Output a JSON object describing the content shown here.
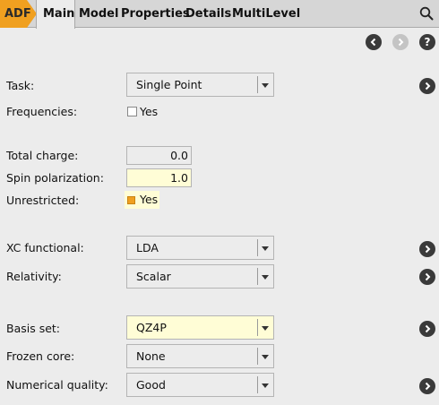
{
  "topbar": {
    "adf_label": "ADF",
    "tabs": [
      "Main",
      "Model",
      "Properties",
      "Details",
      "MultiLevel"
    ]
  },
  "nav": {
    "back_icon": "chevron-left-icon",
    "forward_icon": "chevron-right-icon",
    "help_label": "?"
  },
  "form": {
    "task": {
      "label": "Task:",
      "value": "Single Point"
    },
    "frequencies": {
      "label": "Frequencies:",
      "checkbox_label": "Yes",
      "checked": false
    },
    "total_charge": {
      "label": "Total charge:",
      "value": "0.0"
    },
    "spin_polarization": {
      "label": "Spin polarization:",
      "value": "1.0"
    },
    "unrestricted": {
      "label": "Unrestricted:",
      "checkbox_label": "Yes",
      "checked": true
    },
    "xc_functional": {
      "label": "XC functional:",
      "value": "LDA"
    },
    "relativity": {
      "label": "Relativity:",
      "value": "Scalar"
    },
    "basis_set": {
      "label": "Basis set:",
      "value": "QZ4P"
    },
    "frozen_core": {
      "label": "Frozen core:",
      "value": "None"
    },
    "numerical_quality": {
      "label": "Numerical quality:",
      "value": "Good"
    }
  },
  "colors": {
    "adf_tab": "#f0a020",
    "highlight_field": "#fffdd6",
    "background": "#ececec"
  }
}
